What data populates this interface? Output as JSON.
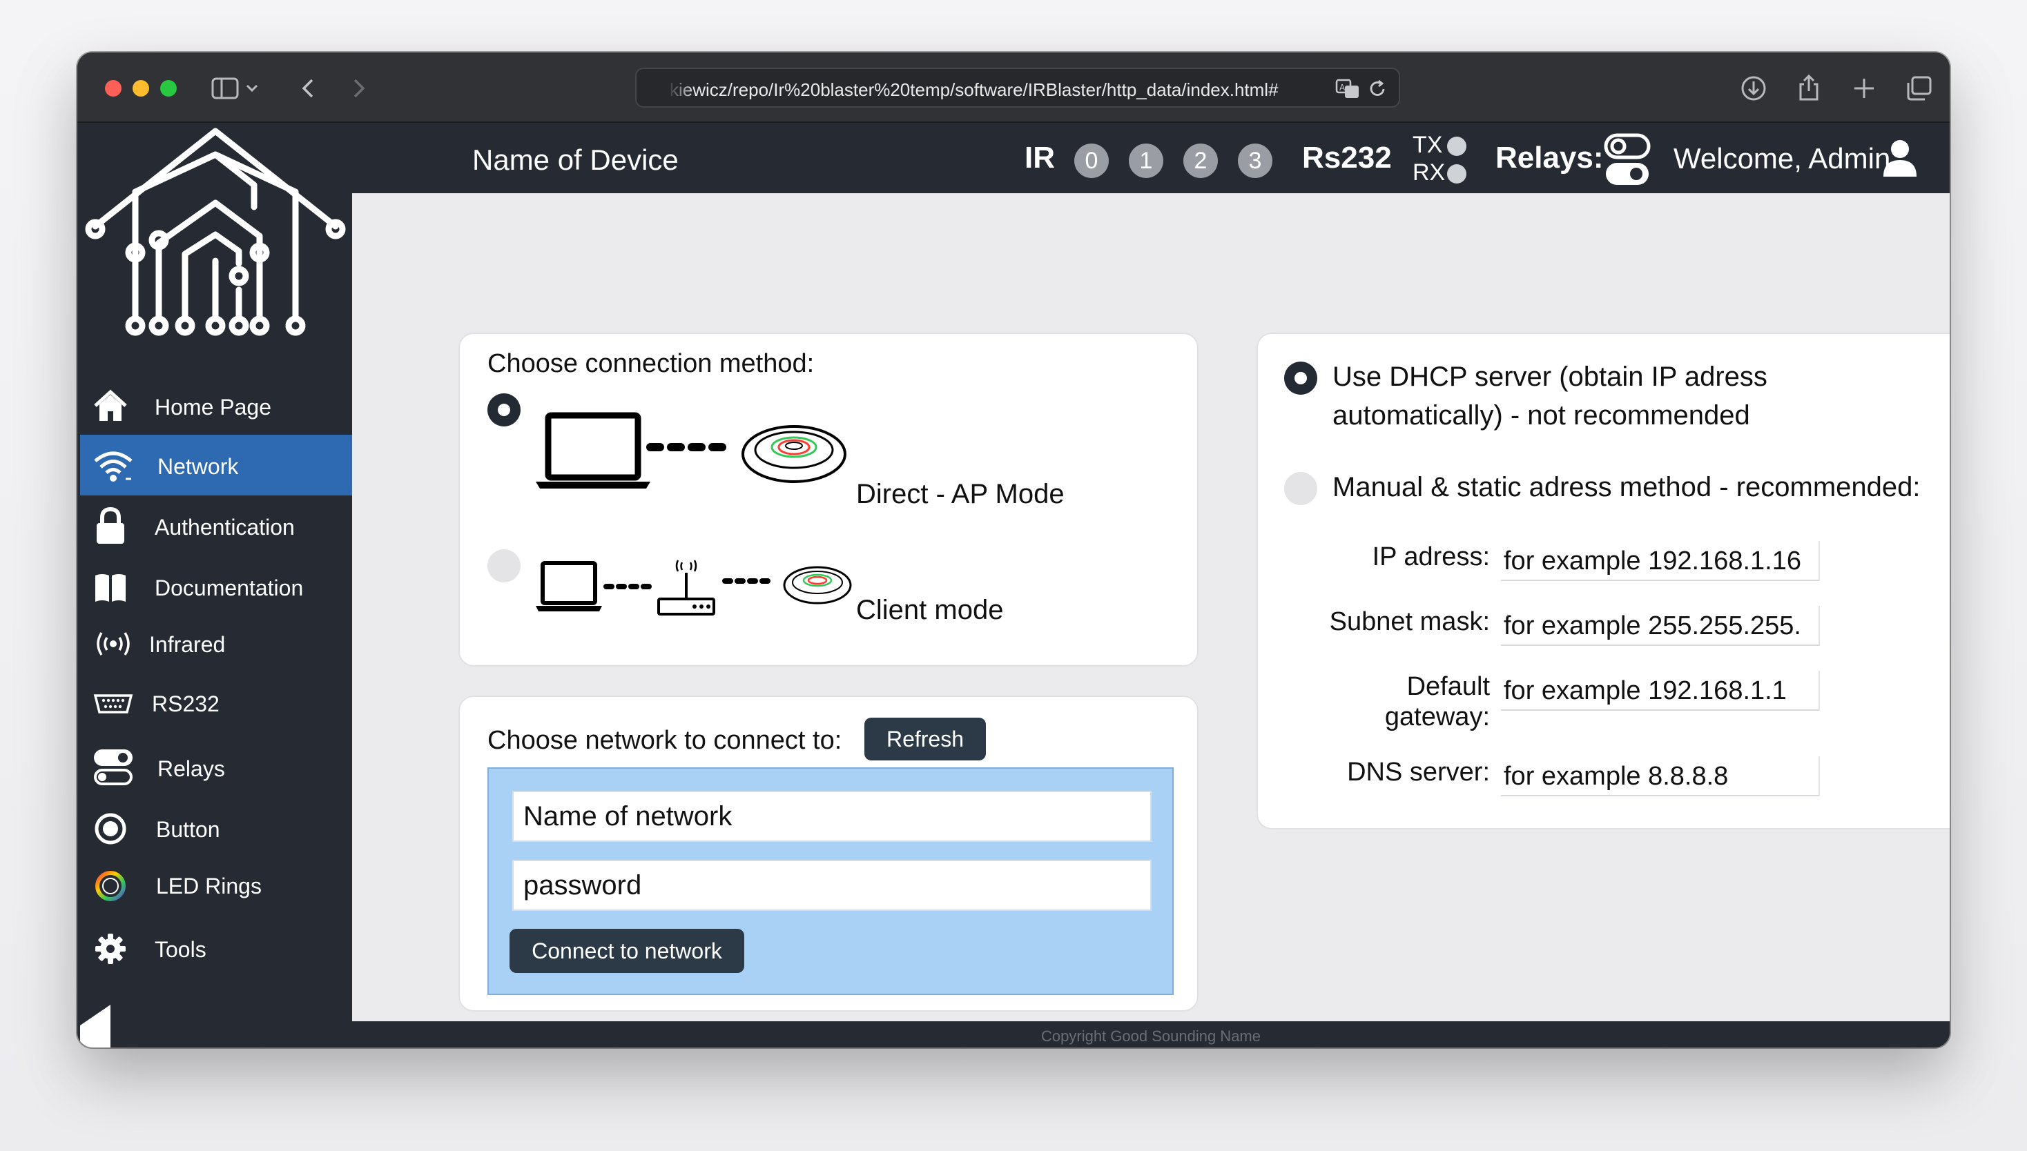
{
  "browser": {
    "url": "kiewicz/repo/Ir%20blaster%20temp/software/IRBlaster/http_data/index.html#"
  },
  "header": {
    "device_name": "Name of Device",
    "ir_label": "IR",
    "ir_channels": [
      "0",
      "1",
      "2",
      "3"
    ],
    "rs232_label": "Rs232",
    "tx_label": "TX",
    "rx_label": "RX",
    "relays_label": "Relays:",
    "welcome": "Welcome, Admin"
  },
  "sidebar": {
    "items": [
      {
        "label": "Home Page",
        "icon": "home-icon"
      },
      {
        "label": "Network",
        "icon": "wifi-icon",
        "active": true
      },
      {
        "label": "Authentication",
        "icon": "lock-icon"
      },
      {
        "label": "Documentation",
        "icon": "book-icon"
      },
      {
        "label": "Infrared",
        "icon": "infrared-icon"
      },
      {
        "label": "RS232",
        "icon": "serial-port-icon"
      },
      {
        "label": "Relays",
        "icon": "toggle-icon"
      },
      {
        "label": "Button",
        "icon": "button-icon"
      },
      {
        "label": "LED Rings",
        "icon": "led-ring-icon"
      },
      {
        "label": "Tools",
        "icon": "gear-icon"
      }
    ]
  },
  "connection_method": {
    "title": "Choose connection method:",
    "direct_label": "Direct - AP Mode",
    "client_label": "Client mode",
    "selected": "direct"
  },
  "network": {
    "title": "Choose network to connect to:",
    "refresh_label": "Refresh",
    "network_name_value": "Name of network",
    "password_value": "password",
    "connect_label": "Connect to network"
  },
  "ip_settings": {
    "dhcp_label_line1": "Use DHCP server (obtain IP adress",
    "dhcp_label_line2": "automatically) - not recommended",
    "manual_label": "Manual & static adress method - recommended:",
    "selected": "dhcp",
    "ip_label": "IP adress:",
    "ip_placeholder": "for example 192.168.1.16",
    "subnet_label": "Subnet mask:",
    "subnet_placeholder": "for example 255.255.255.",
    "gateway_label_line1": "Default",
    "gateway_label_line2": "gateway:",
    "gateway_placeholder": "for example 192.168.1.1",
    "dns_label": "DNS server:",
    "dns_placeholder": "for example 8.8.8.8"
  },
  "footer": {
    "copyright": "Copyright Good Sounding Name"
  },
  "colors": {
    "sidebar_bg": "#262b33",
    "active_nav": "#2e6ab1",
    "button_bg": "#2c3a48",
    "panel_blue": "#a8d1f5"
  }
}
